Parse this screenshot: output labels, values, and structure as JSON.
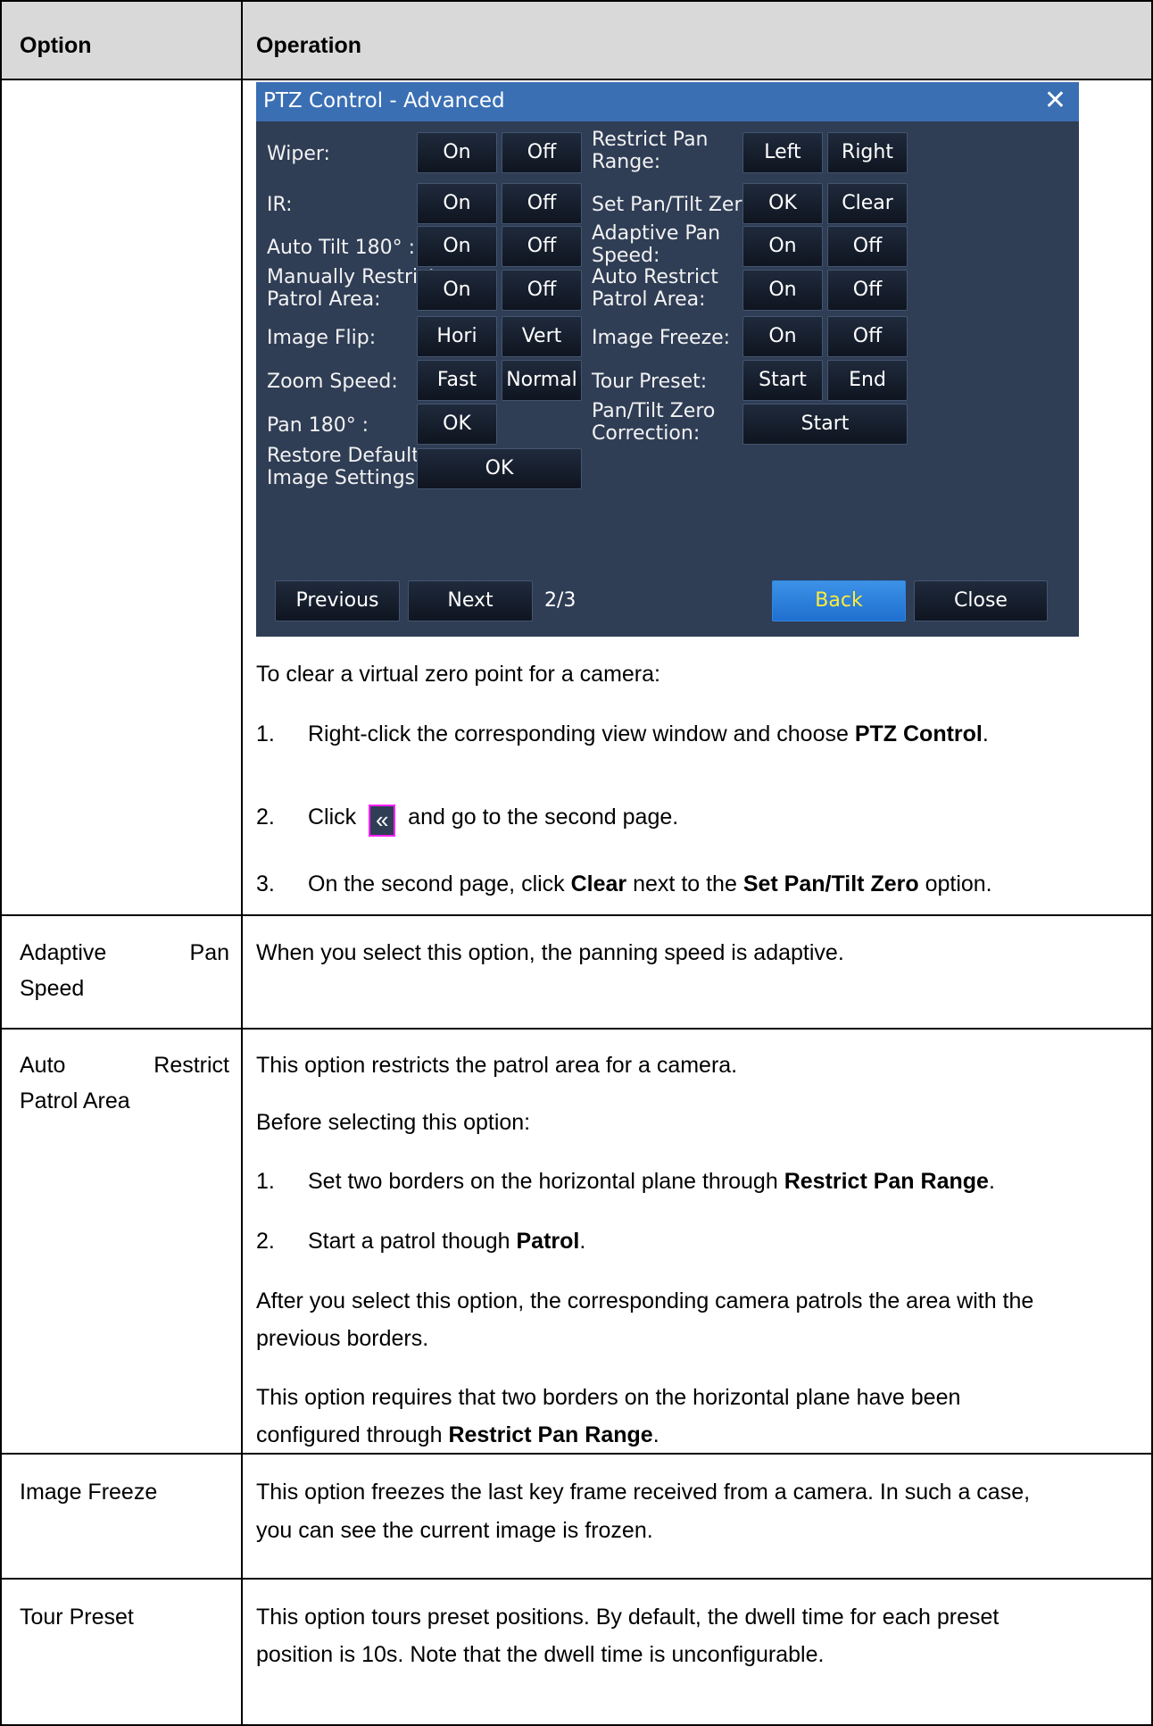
{
  "table": {
    "headers": {
      "option": "Option",
      "operation": "Operation"
    }
  },
  "dialog": {
    "title": "PTZ Control - Advanced",
    "close_icon": "close-x-icon",
    "left_rows": [
      {
        "label": "Wiper:",
        "buttons": [
          "On",
          "Off"
        ]
      },
      {
        "label": "IR:",
        "buttons": [
          "On",
          "Off"
        ]
      },
      {
        "label": "Auto Tilt 180° :",
        "buttons": [
          "On",
          "Off"
        ]
      },
      {
        "label": [
          "Manually Restrict",
          "Patrol Area:"
        ],
        "buttons": [
          "On",
          "Off"
        ]
      },
      {
        "label": "Image Flip:",
        "buttons": [
          "Hori",
          "Vert"
        ]
      },
      {
        "label": "Zoom Speed:",
        "buttons": [
          "Fast",
          "Normal"
        ]
      },
      {
        "label": "Pan 180° :",
        "buttons": [
          "OK"
        ]
      },
      {
        "label": [
          "Restore Default",
          "Image Settings:"
        ],
        "buttons": [
          "OK"
        ]
      }
    ],
    "right_rows": [
      {
        "label": [
          "Restrict Pan",
          "Range:"
        ],
        "buttons": [
          "Left",
          "Right"
        ]
      },
      {
        "label": "Set Pan/Tilt Zero:",
        "buttons": [
          "OK",
          "Clear"
        ]
      },
      {
        "label": [
          "Adaptive Pan",
          "Speed:"
        ],
        "buttons": [
          "On",
          "Off"
        ]
      },
      {
        "label": [
          "Auto Restrict",
          "Patrol Area:"
        ],
        "buttons": [
          "On",
          "Off"
        ]
      },
      {
        "label": "Image Freeze:",
        "buttons": [
          "On",
          "Off"
        ]
      },
      {
        "label": "Tour Preset:",
        "buttons": [
          "Start",
          "End"
        ]
      },
      {
        "label": [
          "Pan/Tilt Zero",
          "Correction:"
        ],
        "buttons": [
          "Start"
        ]
      }
    ],
    "footer": {
      "previous": "Previous",
      "next": "Next",
      "page": "2/3",
      "back": "Back",
      "close": "Close"
    },
    "colors": {
      "background": "#2f3d55",
      "titlebar": "#3a6fb4",
      "back_button": "#2a7fdc",
      "back_text": "#ffeb3b"
    }
  },
  "row1": {
    "intro": "To clear a virtual zero point for a camera:",
    "step1": {
      "num": "1.",
      "pre": "Right-click the corresponding view window and choose ",
      "bold": "PTZ Control",
      "post": "."
    },
    "step2": {
      "num": "2.",
      "pre": "Click",
      "icon": "double-chevron-left-icon",
      "icon_glyph": "«",
      "post": "and go to the second page."
    },
    "step3": {
      "num": "3.",
      "pre": "On the second page, click ",
      "bold1": "Clear",
      "mid": " next to the ",
      "bold2": "Set Pan/Tilt Zero",
      "post": " option."
    }
  },
  "row2": {
    "option_words": [
      "Adaptive",
      "Pan"
    ],
    "option_line2": "Speed",
    "text": "When you select this option, the panning speed is adaptive."
  },
  "row3": {
    "option_words": [
      "Auto",
      "Restrict"
    ],
    "option_line2": "Patrol Area",
    "p1": "This option restricts the patrol area for a camera.",
    "p2": "Before selecting this option:",
    "s1": {
      "num": "1.",
      "pre": "Set two borders on the horizontal plane through ",
      "bold": "Restrict Pan Range",
      "post": "."
    },
    "s2": {
      "num": "2.",
      "pre": "Start a patrol though ",
      "bold": "Patrol",
      "post": "."
    },
    "p3a": "After you select this option, the corresponding camera patrols the area with the",
    "p3b": "previous borders.",
    "p4a": "This option requires that two borders on the horizontal plane have been",
    "p4b_pre": "configured through ",
    "p4b_bold": "Restrict Pan Range",
    "p4b_post": "."
  },
  "row4": {
    "option": "Image Freeze",
    "t1": "This option freezes the last key frame received from a camera. In such a case,",
    "t2": "you can see the current image is frozen."
  },
  "row5": {
    "option": "Tour Preset",
    "t1": "This option tours preset positions. By default, the dwell time for each preset",
    "t2": "position is 10s. Note that the dwell time is unconfigurable."
  }
}
